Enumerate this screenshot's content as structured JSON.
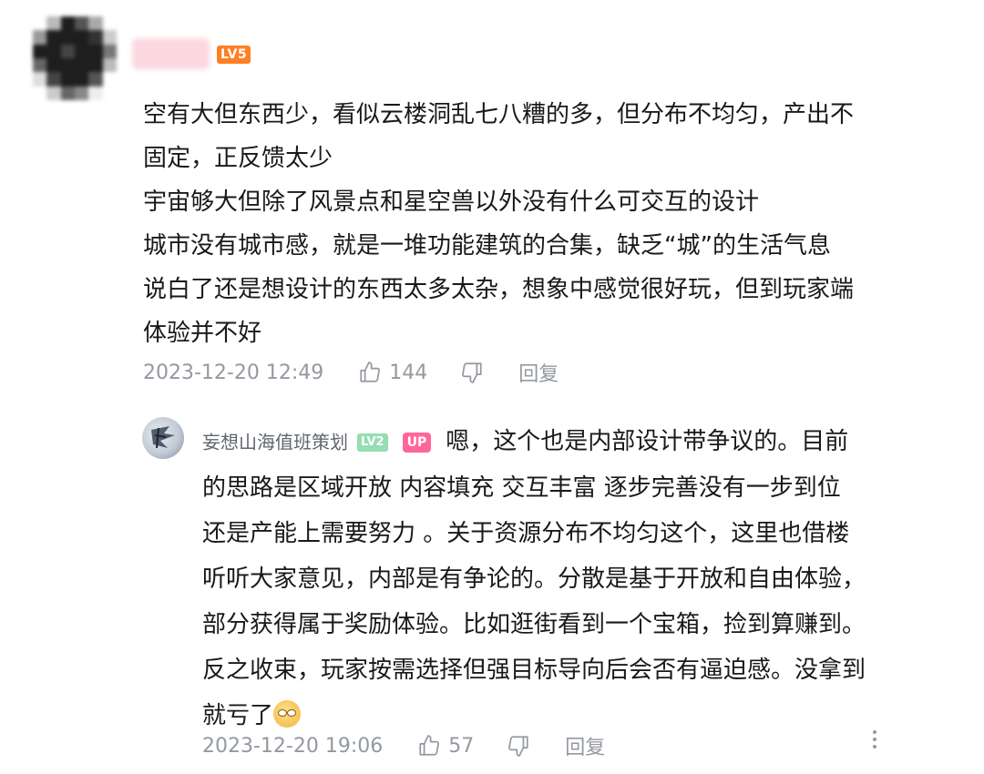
{
  "comment": {
    "level_badge": "LV5",
    "lines": [
      "空有大但东西少，看似云楼洞乱七八糟的多，但分布不均匀，产出不",
      "固定，正反馈太少",
      "宇宙够大但除了风景点和星空兽以外没有什么可交互的设计",
      "城市没有城市感，就是一堆功能建筑的合集，缺乏“城”的生活气息",
      "说白了还是想设计的东西太多太杂，想象中感觉很好玩，但到玩家端",
      "体验并不好"
    ],
    "time": "2023-12-20 12:49",
    "likes": "144",
    "reply_label": "回复",
    "like_icon": "thumb-up-icon",
    "dislike_icon": "thumb-down-icon"
  },
  "reply": {
    "username": "妄想山海值班策划",
    "level_badge": "LV2",
    "up_badge": "UP",
    "first_line": "嗯，这个也是内部设计带争议的。目前",
    "lines": [
      "的思路是区域开放 内容填充 交互丰富 逐步完善没有一步到位",
      "还是产能上需要努力 。关于资源分布不均匀这个，这里也借楼",
      "听听大家意见，内部是有争论的。分散是基于开放和自由体验，",
      "部分获得属于奖励体验。比如逛街看到一个宝箱，捡到算赚到。",
      "反之收束，玩家按需选择但强目标导向后会否有逼迫感。没拿到"
    ],
    "last_line": "就亏了",
    "emoji_icon": "smirk-emoji-icon",
    "time": "2023-12-20 19:06",
    "likes": "57",
    "reply_label": "回复"
  },
  "colors": {
    "lv5": "#ff7f24",
    "lv2": "#95ddb2",
    "up": "#ff6699",
    "meta": "#9499a0",
    "text": "#18191c"
  }
}
